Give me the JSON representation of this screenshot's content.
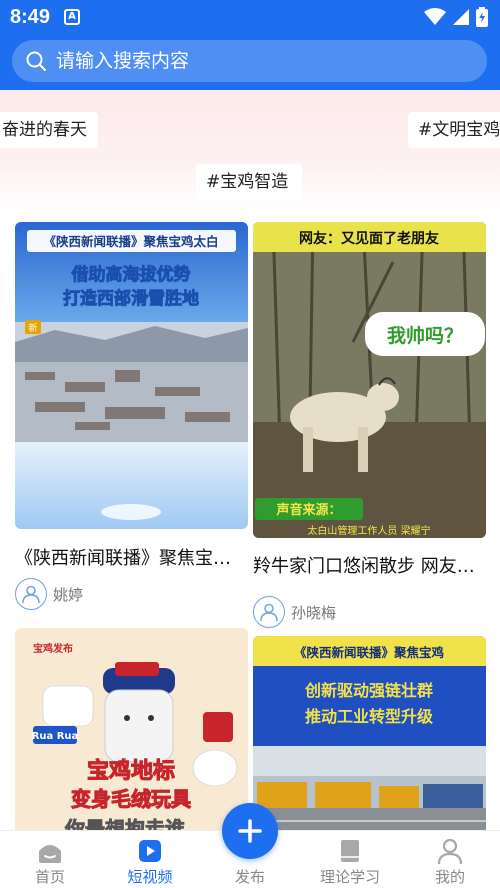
{
  "status_bar": {
    "time": "8:49",
    "app_badge": "A"
  },
  "search": {
    "placeholder": "请输入搜索内容"
  },
  "tags": [
    "奋进的春天",
    "#文明宝鸡",
    "#宝鸡智造"
  ],
  "cards": [
    {
      "title": "《陕西新闻联播》聚焦宝鸡太白 借助高海拔优势",
      "author": "姚婷",
      "thumb_banner": "《陕西新闻联播》聚焦宝鸡太白",
      "thumb_headline_1": "借助高海拔优势",
      "thumb_headline_2": "打造西部滑雪胜地",
      "thumb_tag": "新"
    },
    {
      "title": "羚牛家门口悠闲散步 网友：又见面了老朋友",
      "author": "孙晓梅",
      "thumb_banner": "网友：又见面了老朋友",
      "thumb_bubble": "我帅吗？",
      "thumb_source": "声音来源：",
      "thumb_caption": "太白山管理工作人员 梁耀宁"
    },
    {
      "title": "宝鸡地标变身毛绒玩具",
      "author": "",
      "thumb_logo": "宝鸡发布",
      "thumb_rua": "Rua Rua",
      "thumb_headline_1": "宝鸡地标",
      "thumb_headline_2": "变身毛绒玩具",
      "thumb_bottom": "你最想抱走谁"
    },
    {
      "title": "《陕西新闻联播》聚焦宝鸡 创新驱动强链壮群",
      "author": "",
      "thumb_banner": "《陕西新闻联播》聚焦宝鸡",
      "thumb_headline_1": "创新驱动强链壮群",
      "thumb_headline_2": "推动工业转型升级"
    }
  ],
  "nav": [
    {
      "label": "首页",
      "icon": "home-icon",
      "active": false
    },
    {
      "label": "短视频",
      "icon": "video-play-icon",
      "active": true
    },
    {
      "label": "发布",
      "icon": "plus-icon",
      "active": false
    },
    {
      "label": "理论学习",
      "icon": "book-icon",
      "active": false
    },
    {
      "label": "我的",
      "icon": "person-icon",
      "active": false
    }
  ],
  "colors": {
    "accent": "#1e6ff0",
    "tag_bg": "#fde9ea"
  }
}
